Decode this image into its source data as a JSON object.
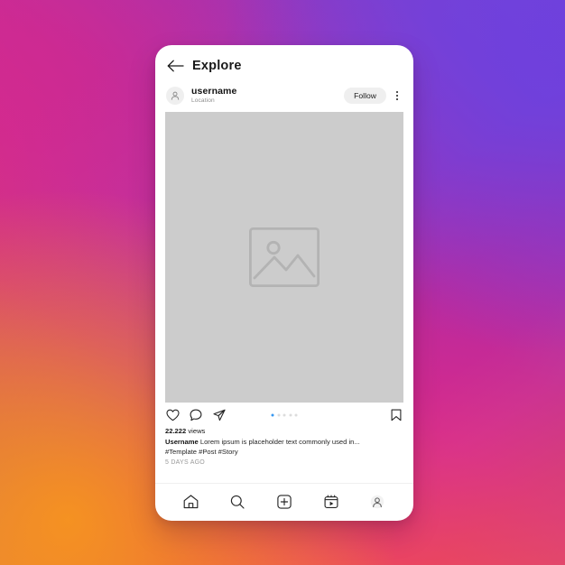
{
  "background": {
    "gradient_colors": [
      "#f58529",
      "#f7921e",
      "#e8386c",
      "#d62b8f",
      "#cc2a8a",
      "#9b35bb",
      "#7340d4",
      "#6c46dd"
    ],
    "description": "instagram-brand-gradient"
  },
  "card": {
    "background": "#ffffff"
  },
  "explore_header": {
    "back_icon": "arrow-left-icon",
    "title": "Explore"
  },
  "post_header": {
    "avatar_icon": "person-icon",
    "username": "username",
    "location": "Location",
    "follow_label": "Follow",
    "menu_icon": "kebab-menu-icon"
  },
  "media": {
    "placeholder_icon": "image-placeholder-icon",
    "fill": "#cccccc"
  },
  "actions": {
    "like_icon": "heart-icon",
    "comment_icon": "comment-icon",
    "share_icon": "paper-plane-icon",
    "save_icon": "bookmark-icon",
    "carousel": {
      "total": 5,
      "active_index": 0,
      "active_color": "#3897f0",
      "inactive_color": "#dcdcdc"
    }
  },
  "caption": {
    "views_count": "22.222",
    "views_label": "views",
    "author": "Username",
    "text": "Lorem ipsum is placeholder text commonly used in...",
    "hashtags": "#Template #Post #Story",
    "timestamp": "5 DAYS AGO"
  },
  "bottom_nav": {
    "items": [
      {
        "name": "home",
        "icon": "home-icon"
      },
      {
        "name": "search",
        "icon": "search-icon"
      },
      {
        "name": "create",
        "icon": "plus-square-icon"
      },
      {
        "name": "reels",
        "icon": "reels-icon"
      },
      {
        "name": "profile",
        "icon": "profile-avatar-icon"
      }
    ]
  }
}
